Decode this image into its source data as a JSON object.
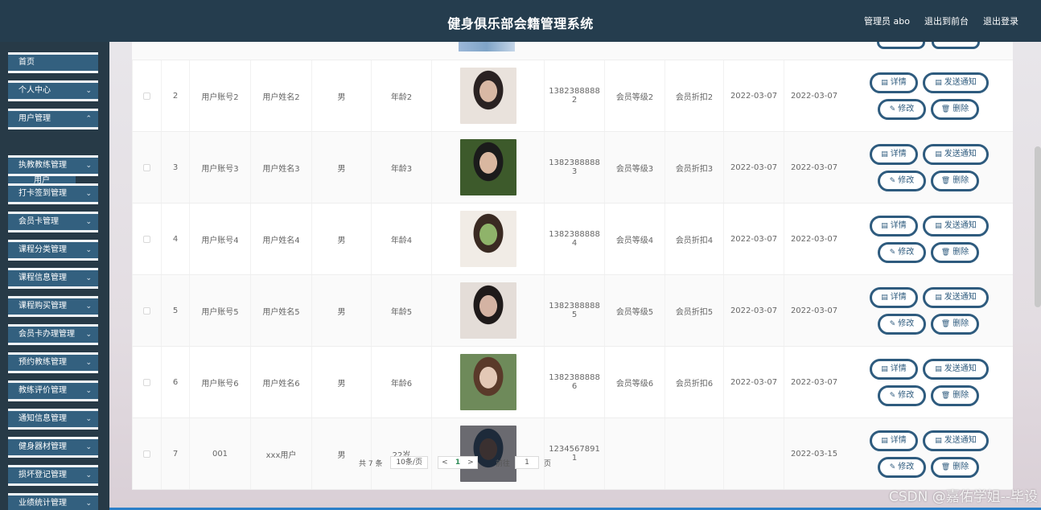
{
  "header": {
    "title": "健身俱乐部会籍管理系统",
    "admin": "管理员 abo",
    "front": "退出到前台",
    "logout": "退出登录"
  },
  "sidebar": {
    "items": [
      {
        "label": "首页",
        "chev": ""
      },
      {
        "label": "个人中心",
        "chev": "⌄"
      },
      {
        "label": "用户管理",
        "chev": "⌃"
      },
      {
        "label": "执教教练管理",
        "chev": "⌄"
      },
      {
        "label": "打卡签到管理",
        "chev": "⌄"
      },
      {
        "label": "会员卡管理",
        "chev": "⌄"
      },
      {
        "label": "课程分类管理",
        "chev": "⌄"
      },
      {
        "label": "课程信息管理",
        "chev": "⌄"
      },
      {
        "label": "课程购买管理",
        "chev": "⌄"
      },
      {
        "label": "会员卡办理管理",
        "chev": "⌄"
      },
      {
        "label": "预约教练管理",
        "chev": "⌄"
      },
      {
        "label": "教练评价管理",
        "chev": "⌄"
      },
      {
        "label": "通知信息管理",
        "chev": "⌄"
      },
      {
        "label": "健身器材管理",
        "chev": "⌄"
      },
      {
        "label": "损坏登记管理",
        "chev": "⌄"
      },
      {
        "label": "业绩统计管理",
        "chev": "⌄"
      }
    ],
    "submenu": "用户"
  },
  "table": {
    "rows": [
      {
        "no": "2",
        "account": "用户账号2",
        "name": "用户姓名2",
        "gender": "男",
        "age": "年龄2",
        "phone": "13823888882",
        "level": "会员等级2",
        "discount": "会员折扣2",
        "date1": "2022-03-07",
        "date2": "2022-03-07",
        "photo_colors": [
          "#e9e2dc",
          "#2a2222",
          "#d8b8a4"
        ]
      },
      {
        "no": "3",
        "account": "用户账号3",
        "name": "用户姓名3",
        "gender": "男",
        "age": "年龄3",
        "phone": "13823888883",
        "level": "会员等级3",
        "discount": "会员折扣3",
        "date1": "2022-03-07",
        "date2": "2022-03-07",
        "photo_colors": [
          "#3d5a2b",
          "#1b1b1b",
          "#d9b7a0"
        ]
      },
      {
        "no": "4",
        "account": "用户账号4",
        "name": "用户姓名4",
        "gender": "男",
        "age": "年龄4",
        "phone": "13823888884",
        "level": "会员等级4",
        "discount": "会员折扣4",
        "date1": "2022-03-07",
        "date2": "2022-03-07",
        "photo_colors": [
          "#f1ece6",
          "#3a2a22",
          "#8fb36a"
        ]
      },
      {
        "no": "5",
        "account": "用户账号5",
        "name": "用户姓名5",
        "gender": "男",
        "age": "年龄5",
        "phone": "13823888885",
        "level": "会员等级5",
        "discount": "会员折扣5",
        "date1": "2022-03-07",
        "date2": "2022-03-07",
        "photo_colors": [
          "#e4ddd8",
          "#1f1a1a",
          "#d4b3a3"
        ]
      },
      {
        "no": "6",
        "account": "用户账号6",
        "name": "用户姓名6",
        "gender": "男",
        "age": "年龄6",
        "phone": "13823888886",
        "level": "会员等级6",
        "discount": "会员折扣6",
        "date1": "2022-03-07",
        "date2": "2022-03-07",
        "photo_colors": [
          "#6e8a5a",
          "#5a3a2a",
          "#e3c8b6"
        ]
      },
      {
        "no": "7",
        "account": "001",
        "name": "xxx用户",
        "gender": "男",
        "age": "22岁",
        "phone": "12345678911",
        "level": "",
        "discount": "",
        "date1": "",
        "date2": "2022-03-15",
        "photo_colors": [
          "#6a6a70",
          "#1d2a3a",
          "#3a3030"
        ]
      }
    ],
    "buttons": {
      "detail": "详情",
      "notify": "发送通知",
      "edit": "修改",
      "delete": "删除"
    }
  },
  "pagination": {
    "total": "共 7 条",
    "page_size": "10条/页",
    "prev": "<",
    "current": "1",
    "next": ">",
    "goto": "前往",
    "goto_value": "1",
    "page_unit": "页"
  },
  "watermark": "CSDN @嘉佑学姐--毕设"
}
